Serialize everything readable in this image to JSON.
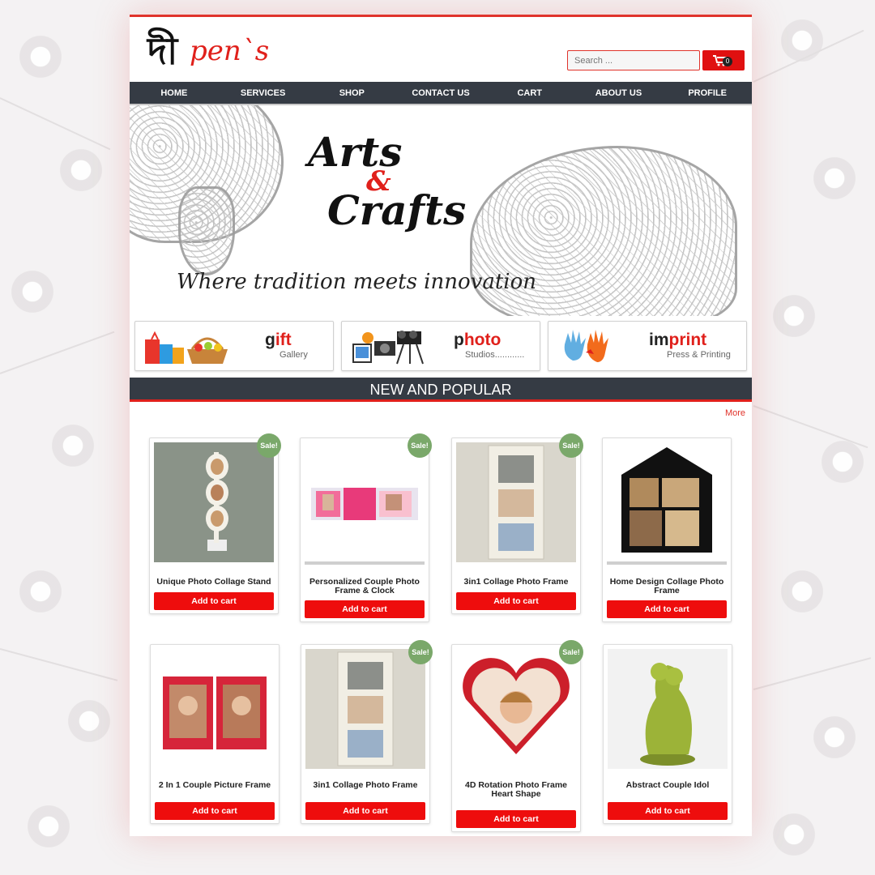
{
  "brand": {
    "logo_mark": "দী",
    "logo_text": "pen`s"
  },
  "search": {
    "placeholder": "Search ..."
  },
  "cart": {
    "count": "0"
  },
  "nav": [
    "HOME",
    "SERVICES",
    "SHOP",
    "CONTACT US",
    "CART",
    "ABOUT US",
    "PROFILE"
  ],
  "hero": {
    "line1": "Arts",
    "amp": "&",
    "line2": "Crafts",
    "tagline": "Where tradition meets innovation"
  },
  "categories": [
    {
      "title_accent": "g",
      "title_rest": "ift",
      "subtitle": "Gallery"
    },
    {
      "title_accent": "p",
      "title_rest": "hoto",
      "subtitle": "Studios............"
    },
    {
      "title_accent": "im",
      "title_rest": "print",
      "subtitle": "Press & Printing"
    }
  ],
  "section": {
    "title": "NEW AND POPULAR",
    "more": "More"
  },
  "sale_label": "Sale!",
  "add_to_cart": "Add to cart",
  "products": [
    {
      "name": "Unique Photo Collage Stand",
      "sale": true
    },
    {
      "name": "Personalized Couple Photo Frame & Clock",
      "sale": true
    },
    {
      "name": "3in1 Collage Photo Frame",
      "sale": true
    },
    {
      "name": "Home Design Collage Photo Frame",
      "sale": false
    },
    {
      "name": "2 In 1 Couple Picture Frame",
      "sale": false
    },
    {
      "name": "3in1 Collage Photo Frame",
      "sale": true
    },
    {
      "name": "4D Rotation Photo Frame Heart Shape",
      "sale": true
    },
    {
      "name": "Abstract Couple Idol",
      "sale": false
    }
  ],
  "colors": {
    "accent": "#e0201b",
    "nav": "#353b44",
    "sale": "#7aa86a",
    "button": "#ee0d0d"
  }
}
